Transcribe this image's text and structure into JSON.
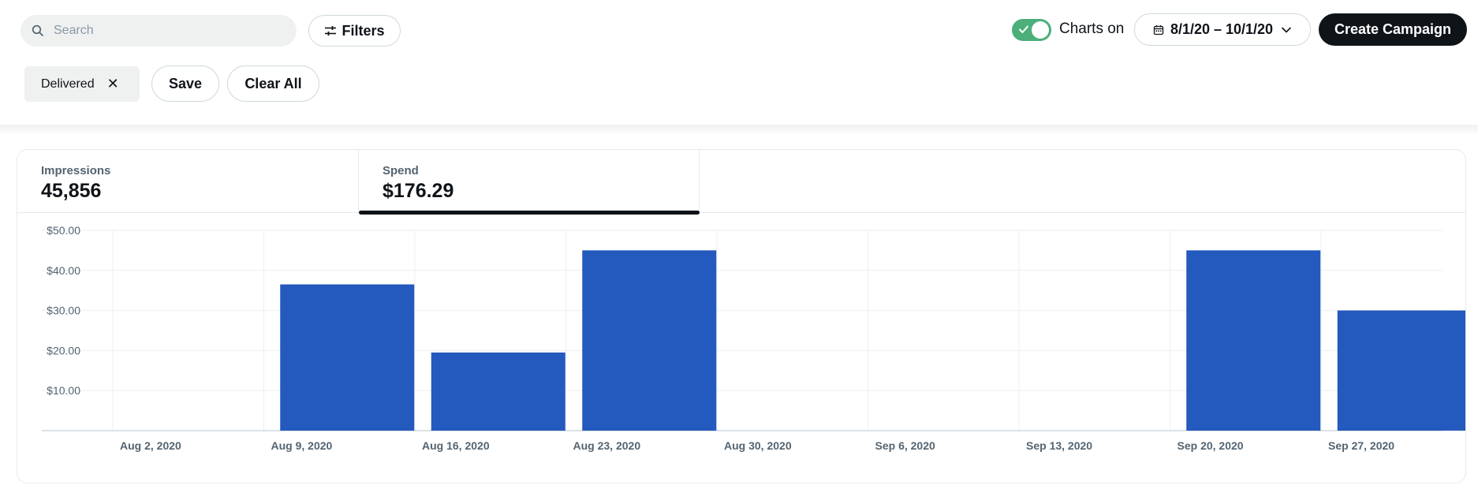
{
  "search": {
    "placeholder": "Search"
  },
  "toolbar": {
    "filters_label": "Filters",
    "charts_toggle_label": "Charts on",
    "charts_toggle_on": true,
    "date_range": "8/1/20 – 10/1/20",
    "create_label": "Create Campaign"
  },
  "filter_chips": [
    {
      "label": "Delivered"
    }
  ],
  "filter_actions": {
    "save_label": "Save",
    "clear_label": "Clear All"
  },
  "metrics": [
    {
      "label": "Impressions",
      "value": "45,856",
      "selected": false
    },
    {
      "label": "Spend",
      "value": "$176.29",
      "selected": true
    }
  ],
  "colors": {
    "bar": "#2459bd",
    "accent_toggle": "#4caf7a",
    "primary_dark": "#0f1419"
  },
  "chart_data": {
    "type": "bar",
    "categories": [
      "Aug 2, 2020",
      "Aug 9, 2020",
      "Aug 16, 2020",
      "Aug 23, 2020",
      "Aug 30, 2020",
      "Sep 6, 2020",
      "Sep 13, 2020",
      "Sep 20, 2020",
      "Sep 27, 2020"
    ],
    "values": [
      0,
      36.5,
      19.5,
      45,
      0,
      0,
      0,
      45,
      30
    ],
    "y_ticks": [
      "$10.00",
      "$20.00",
      "$30.00",
      "$40.00",
      "$50.00"
    ],
    "y_tick_values": [
      10,
      20,
      30,
      40,
      50
    ],
    "ylim": [
      0,
      50
    ],
    "grid": true
  }
}
